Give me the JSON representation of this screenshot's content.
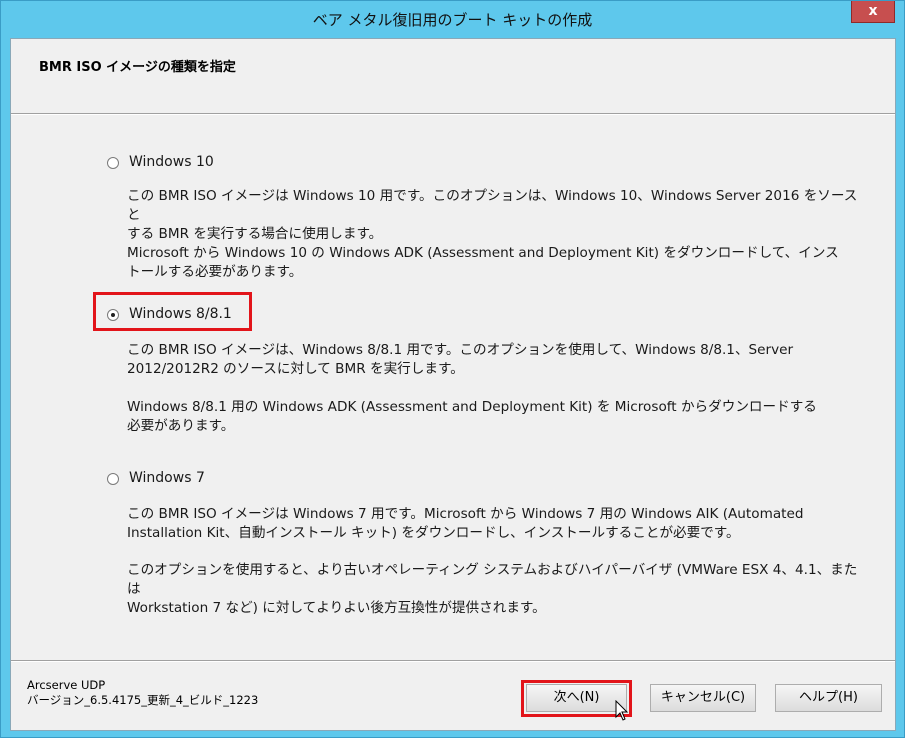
{
  "window": {
    "title": "ベア メタル復旧用のブート キットの作成",
    "close_label": "x"
  },
  "header": {
    "title": "BMR ISO イメージの種類を指定"
  },
  "options": [
    {
      "label": "Windows 10",
      "selected": false,
      "desc1_line1": "この BMR ISO イメージは Windows 10 用です。このオプションは、Windows 10、Windows Server 2016 をソースと",
      "desc1_line2": "する BMR を実行する場合に使用します。",
      "desc2_line1": "Microsoft から Windows 10 の Windows ADK (Assessment and Deployment Kit) をダウンロードして、インス",
      "desc2_line2": "トールする必要があります。"
    },
    {
      "label": "Windows 8/8.1",
      "selected": true,
      "desc1_line1": "この BMR ISO イメージは、Windows 8/8.1 用です。このオプションを使用して、Windows 8/8.1、Server",
      "desc1_line2": "2012/2012R2 のソースに対して BMR を実行します。",
      "desc2_line1": "Windows 8/8.1 用の Windows ADK (Assessment and Deployment Kit) を Microsoft からダウンロードする",
      "desc2_line2": "必要があります。"
    },
    {
      "label": "Windows 7",
      "selected": false,
      "desc1_line1": "この BMR ISO イメージは Windows 7 用です。Microsoft から Windows 7 用の Windows AIK (Automated",
      "desc1_line2": "Installation Kit、自動インストール キット) をダウンロードし、インストールすることが必要です。",
      "desc2_line1": "このオプションを使用すると、より古いオペレーティング システムおよびハイパーバイザ (VMWare ESX 4、4.1、または",
      "desc2_line2": "Workstation 7 など) に対してよりよい後方互換性が提供されます。"
    }
  ],
  "footer": {
    "product": "Arcserve UDP",
    "version": "バージョン_6.5.4175_更新_4_ビルド_1223"
  },
  "buttons": {
    "next": "次へ(N)",
    "cancel": "キャンセル(C)",
    "help": "ヘルプ(H)"
  },
  "colors": {
    "title_bar": "#5ec8ec",
    "highlight": "#e2141a",
    "close_button": "#c74f4f"
  }
}
